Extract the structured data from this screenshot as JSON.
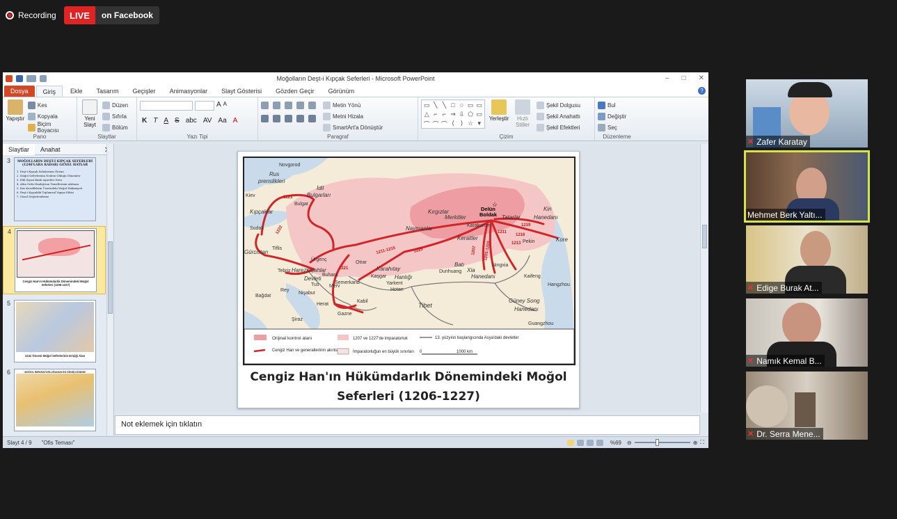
{
  "recording": {
    "label": "Recording"
  },
  "live": {
    "badge": "LIVE",
    "platform": "on Facebook"
  },
  "ppt": {
    "window_title": "Moğolların Deşt-i Kıpçak Seferleri  -  Microsoft PowerPoint",
    "tabs": [
      "Dosya",
      "Giriş",
      "Ekle",
      "Tasarım",
      "Geçişler",
      "Animasyonlar",
      "Slayt Gösterisi",
      "Gözden Geçir",
      "Görünüm"
    ],
    "active_tab": "Giriş",
    "ribbon": {
      "pano": {
        "label": "Pano",
        "paste": "Yapıştır",
        "cut": "Kes",
        "copy": "Kopyala",
        "format_painter": "Biçim Boyacısı"
      },
      "slaytlar": {
        "label": "Slaytlar",
        "new_slide": "Yeni Slayt",
        "layout": "Düzen",
        "reset": "Sıfırla",
        "section": "Bölüm"
      },
      "yazi_tipi": {
        "label": "Yazı Tipi",
        "bold": "K",
        "italic": "T",
        "underline": "A",
        "strike": "S",
        "shadow": "abc",
        "spacing": "AV",
        "case": "Aa",
        "color": "A"
      },
      "paragraf": {
        "label": "Paragraf",
        "text_direction": "Metin Yönü",
        "align_text": "Metni Hizala",
        "smartart": "SmartArt'a Dönüştür"
      },
      "cizim": {
        "label": "Çizim",
        "arrange": "Yerleştir",
        "quick_styles": "Hızlı Stiller",
        "fill": "Şekil Dolgusu",
        "outline": "Şekil Anahattı",
        "effects": "Şekil Efektleri"
      },
      "duzenleme": {
        "label": "Düzenleme",
        "find": "Bul",
        "replace": "Değiştir",
        "select": "Seç"
      }
    },
    "pane_tabs": [
      "Slaytlar",
      "Anahat"
    ],
    "thumbnails": [
      {
        "num": "3",
        "title": "MOĞOLLARIN DEŞT-İ KIPÇAK SEFERLERİ",
        "subtitle": "(1240'LARA KADAR) GENEL HATLAR",
        "items": [
          "1. Deşt-i Kıpçak Sahalarının Önemi",
          "2. Moğol Seferlerinin Nedeni Olduğu Dönemler",
          "3. Eldi Siyasi Batılı Aşiretler Notu",
          "4. Altın Orda Hanlığı'nın Temellerinin Atılması",
          "5. Rus Knezliklerin Üzerindeki Moğol Hakimiyeti",
          "6. Deşt-i Kıpçaklık Toplumsal Yapıya Etkisi",
          "7. Genel Değerlendirme"
        ]
      },
      {
        "num": "4",
        "caption": "Cengiz Han'ın Hükümdarlık Dönemindeki Moğol Seferleri (1206-1227)"
      },
      {
        "num": "5",
        "caption": "1241 Öncesi Moğol Seferlerinin Erişiği Alan"
      },
      {
        "num": "6",
        "caption": "MOĞOL İMPARATORLUĞUNUN EN GENİŞ DÖNEMİ"
      }
    ],
    "slide": {
      "caption_line1": "Cengiz Han'ın Hükümdarlık Dönemindeki Moğol",
      "caption_line2": "Seferleri (1206-1227)",
      "map_labels": {
        "novgorod": "Novgorod",
        "rus1": "Rus",
        "rus2": "prenslikleri",
        "idil1": "İdil",
        "idil2": "Bulgarları",
        "kiev": "Kiev",
        "bulgar": "Bulgar",
        "kipcaklar": "Kıpçaklar",
        "sudak": "Sudak",
        "gurcistan": "Gürcistan",
        "tiflis": "Tiflis",
        "tebriz": "Tebriz",
        "rey": "Rey",
        "bagdat": "Bağdat",
        "siraz": "Şiraz",
        "urgenc": "Ürgenç",
        "harezm1": "Harezmşahlar",
        "harezm2": "Devleti",
        "buhara": "Buhara",
        "semerkand": "Semerkand",
        "otrar": "Otrar",
        "tus": "Tus",
        "merv": "Merv",
        "nisabur": "Nişabur",
        "herat": "Herat",
        "gazne": "Gazne",
        "kabil": "Kabil",
        "kasgar": "Kaşgar",
        "yarkent": "Yarkent",
        "hotan": "Hotan",
        "karahitay1": "Karahıtay",
        "karahitay2": "Hanlığı",
        "naymanlar": "Naymanlar",
        "kirgizlar": "Kırgızlar",
        "merkitler": "Merkitler",
        "karakurum": "Karakurum",
        "deluun1": "Delün",
        "deluun2": "Boldak",
        "tatarlar": "Tatarlar",
        "kin1": "Kin",
        "kin2": "Hanedanı",
        "kereitler": "Keraitler",
        "bati1": "Batı",
        "bati2": "Xia",
        "bati3": "Hanedanı",
        "dunhuang": "Dunhuang",
        "ningxia": "Ningxia",
        "pekin": "Pekin",
        "kore": "Kore",
        "tibet": "Tibet",
        "kaifeng": "Kaifeng",
        "hangzhou": "Hangzhou",
        "songHanedani1": "Güney Song",
        "songHanedani2": "Hanedanı",
        "guangzhou": "Guangzhou"
      },
      "years": [
        "1223",
        "1222",
        "1221",
        "1211-1215",
        "1225",
        "1219",
        "1211",
        "1216",
        "1213",
        "1205-1209",
        "1207"
      ],
      "legend": {
        "control": "Orijinal kontrol alanı",
        "empire": "1207 ve 1227'de imparatorluk",
        "largest": "İmparatorluğun en büyük sınırları",
        "campaigns": "Cengiz Han ve generallerinin akınları",
        "states": "13. yüzyılın başlangıcında Asya'daki devletler",
        "scale_start": "0",
        "scale_end": "1000 km"
      }
    },
    "notes_placeholder": "Not eklemek için tıklatın",
    "status": {
      "slide": "Slayt 4 / 9",
      "theme": "\"Ofis Teması\"",
      "zoom": "%69"
    }
  },
  "participants": [
    {
      "name": "Zafer Karatay"
    },
    {
      "name": "Mehmet Berk Yaltı..."
    },
    {
      "name": "Edige Burak At..."
    },
    {
      "name": "Namık Kemal B..."
    },
    {
      "name": "Dr. Serra Mene..."
    }
  ],
  "colors": {
    "live": "#e02424",
    "file_tab": "#d24726",
    "highlight": "#d7e34a",
    "campaign": "#d0262a",
    "empire": "#f4b8b8"
  }
}
